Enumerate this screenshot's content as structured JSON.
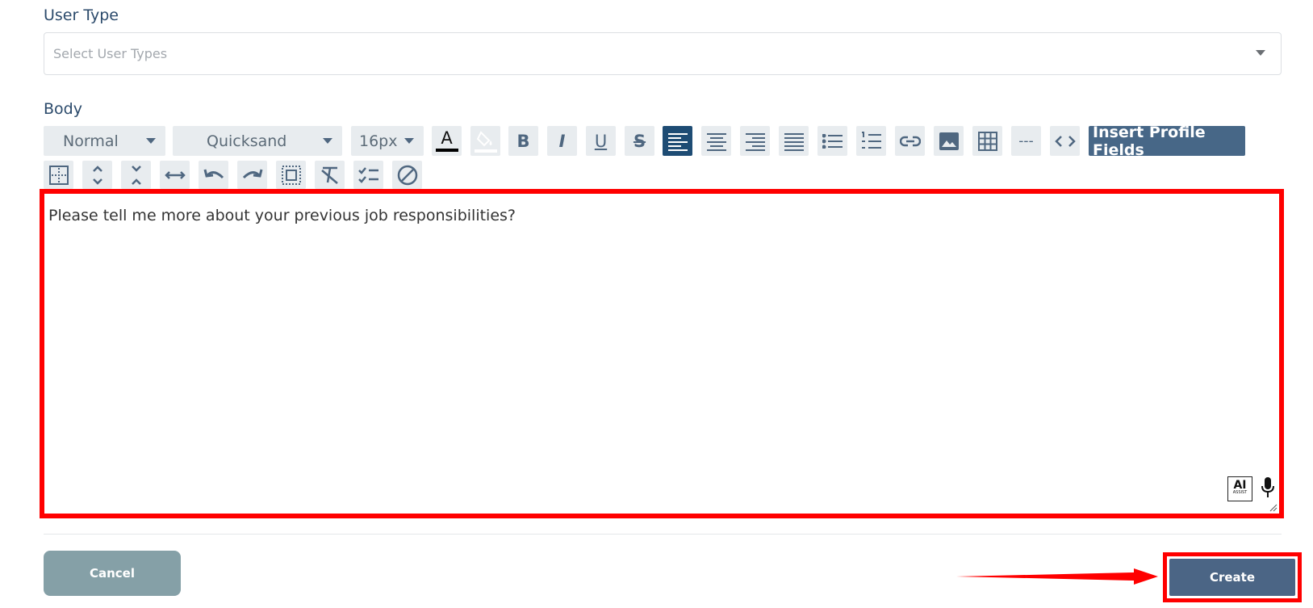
{
  "form": {
    "user_type_label": "User Type",
    "user_type_placeholder": "Select User Types",
    "body_label": "Body"
  },
  "toolbar": {
    "format_value": "Normal",
    "font_value": "Quicksand",
    "size_value": "16px",
    "hr_label": "---",
    "insert_profile_fields": "Insert Profile Fields",
    "bold_glyph": "B",
    "italic_glyph": "I",
    "underline_glyph": "U",
    "strike_glyph": "S",
    "text_color_glyph": "A"
  },
  "editor": {
    "content": "Please tell me more about your previous job responsibilities?",
    "ai_label": "AI",
    "ai_sub": "ASSIST"
  },
  "actions": {
    "cancel_label": "Cancel",
    "create_label": "Create"
  },
  "colors": {
    "accent": "#1e4c74",
    "button_primary": "#4b6585",
    "button_secondary": "#85a0a7",
    "highlight": "#ff0000"
  }
}
